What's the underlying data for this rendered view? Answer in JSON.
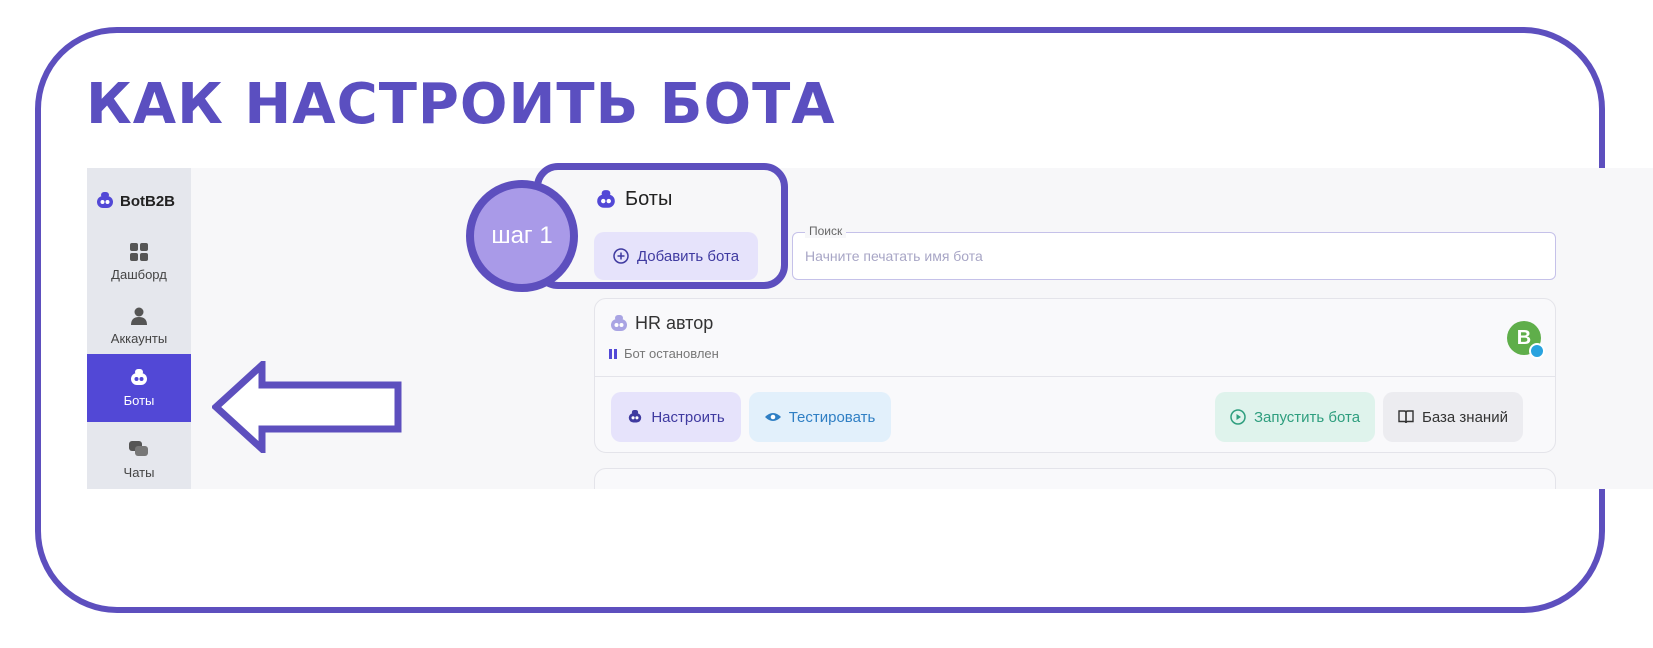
{
  "page": {
    "title": "КАК НАСТРОИТЬ БОТА"
  },
  "sidebar": {
    "brand": "BotB2B",
    "items": [
      {
        "label": "Дашборд",
        "icon": "grid-icon"
      },
      {
        "label": "Аккаунты",
        "icon": "user-icon"
      },
      {
        "label": "Боты",
        "icon": "bot-icon",
        "active": true
      },
      {
        "label": "Чаты",
        "icon": "chat-icon"
      }
    ]
  },
  "main": {
    "title": "Боты",
    "add_button": "Добавить бота",
    "search": {
      "legend": "Поиск",
      "placeholder": "Начните печатать имя бота"
    },
    "bot_card": {
      "name": "HR автор",
      "status": "Бот остановлен",
      "avatar_letter": "B",
      "buttons": {
        "configure": "Настроить",
        "test": "Тестировать",
        "start": "Запустить бота",
        "knowledge": "База знаний"
      }
    }
  },
  "annotation": {
    "step": "шаг 1"
  },
  "colors": {
    "accent": "#5d4fbe",
    "active_nav": "#5248d6",
    "start_green": "#2e9e7e",
    "test_blue": "#2f7fc4"
  }
}
